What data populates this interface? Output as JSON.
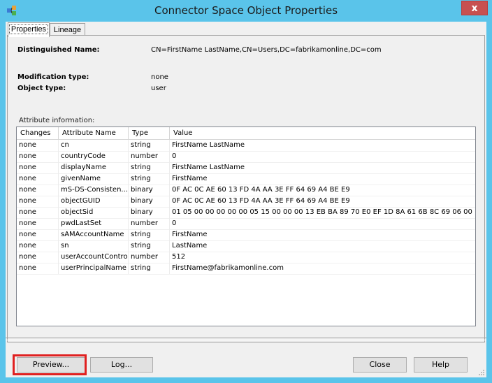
{
  "window": {
    "title": "Connector Space Object Properties",
    "close_label": "x"
  },
  "tabs": [
    {
      "label": "Properties"
    },
    {
      "label": "Lineage"
    }
  ],
  "properties": {
    "dn_label": "Distinguished Name:",
    "dn_value": "CN=FirstName LastName,CN=Users,DC=fabrikamonline,DC=com",
    "mod_type_label": "Modification type:",
    "mod_type_value": "none",
    "obj_type_label": "Object type:",
    "obj_type_value": "user",
    "attr_info_label": "Attribute information:"
  },
  "table": {
    "columns": [
      "Changes",
      "Attribute Name",
      "Type",
      "Value"
    ],
    "rows": [
      [
        "none",
        "cn",
        "string",
        "FirstName   LastName"
      ],
      [
        "none",
        "countryCode",
        "number",
        "0"
      ],
      [
        "none",
        "displayName",
        "string",
        "FirstName   LastName"
      ],
      [
        "none",
        "givenName",
        "string",
        "FirstName"
      ],
      [
        "none",
        "mS-DS-Consisten...",
        "binary",
        "0F AC 0C AE 60 13 FD 4A AA 3E FF 64 69 A4 BE E9"
      ],
      [
        "none",
        "objectGUID",
        "binary",
        "0F AC 0C AE 60 13 FD 4A AA 3E FF 64 69 A4 BE E9"
      ],
      [
        "none",
        "objectSid",
        "binary",
        "01 05 00 00 00 00 00 05 15 00 00 00 13 EB BA 89 70 E0 EF 1D 8A 61 6B 8C 69 06 00 ..."
      ],
      [
        "none",
        "pwdLastSet",
        "number",
        "0"
      ],
      [
        "none",
        "sAMAccountName",
        "string",
        "FirstName"
      ],
      [
        "none",
        "sn",
        "string",
        "LastName"
      ],
      [
        "none",
        "userAccountControl",
        "number",
        "512"
      ],
      [
        "none",
        "userPrincipalName",
        "string",
        "FirstName@fabrikamonline.com"
      ]
    ]
  },
  "buttons": {
    "preview": "Preview...",
    "log": "Log...",
    "close": "Close",
    "help": "Help"
  },
  "colors": {
    "titlebar": "#5ac4ea",
    "close": "#c75050",
    "highlight": "#e02020"
  }
}
